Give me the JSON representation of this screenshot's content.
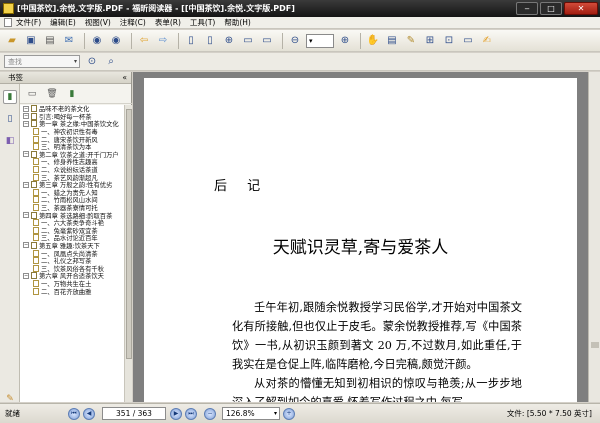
{
  "window": {
    "title": "[中国茶饮].余悦.文字版.PDF - 福昕阅读器 - [[中国茶饮].余悦.文字版.PDF]"
  },
  "menu": [
    "文件(F)",
    "编辑(E)",
    "视图(V)",
    "注释(C)",
    "表单(R)",
    "工具(T)",
    "帮助(H)"
  ],
  "toolbar": {
    "icons": [
      "open-icon",
      "save-icon",
      "print-icon",
      "email-icon",
      "first-page-icon",
      "prev-page-icon",
      "back-icon",
      "forward-icon",
      "single-page-icon",
      "facing-icon",
      "zoom-in-icon",
      "fit-page-icon",
      "fit-width-icon",
      "zoom-out-icon",
      "zoom-plus-icon",
      "hand-tool-icon",
      "select-text-icon",
      "snapshot-icon",
      "comment-icon",
      "link-icon",
      "typewriter-icon",
      "note-icon"
    ]
  },
  "search": {
    "placeholder": "查找"
  },
  "left_panel": {
    "header": "书签",
    "bookmarks": [
      {
        "level": 1,
        "label": "品味不老的茶文化"
      },
      {
        "level": 1,
        "label": "引言:喝好每一杯茶"
      },
      {
        "level": 1,
        "label": "第一章 茶之缘:中国茶饮文化"
      },
      {
        "level": 2,
        "label": "一、神农初识性有毒"
      },
      {
        "level": 2,
        "label": "二、唐宋茶饮开新风"
      },
      {
        "level": 2,
        "label": "三、明清茶饮为本"
      },
      {
        "level": 1,
        "label": "第二章 饮茶之道:开千门万户"
      },
      {
        "level": 2,
        "label": "一、修身养性志趣高"
      },
      {
        "level": 2,
        "label": "二、众说纷纭话茶道"
      },
      {
        "level": 2,
        "label": "三、茶艺风韵渐超凡"
      },
      {
        "level": 1,
        "label": "第三章 万般之韵:性有优劣"
      },
      {
        "level": 2,
        "label": "一、蜡之为贵先人知"
      },
      {
        "level": 2,
        "label": "二、竹雨松风山水间"
      },
      {
        "level": 2,
        "label": "三、茶器茶寮情可托"
      },
      {
        "level": 1,
        "label": "第四章 茶选路细:酌取百茶"
      },
      {
        "level": 2,
        "label": "一、六大茶类争奇斗艳"
      },
      {
        "level": 2,
        "label": "二、兔毫紫砂双宜茶"
      },
      {
        "level": 2,
        "label": "三、品水讨论近百年"
      },
      {
        "level": 1,
        "label": "第五章 雅趣:饮茶天下"
      },
      {
        "level": 2,
        "label": "一、凤凰点头尚清茶"
      },
      {
        "level": 2,
        "label": "二、礼仪之邦写茶"
      },
      {
        "level": 2,
        "label": "三、饮茶风俗各有千秋"
      },
      {
        "level": 1,
        "label": "第六章 风开合适茶饮天"
      },
      {
        "level": 2,
        "label": "一、万物共生在土"
      },
      {
        "level": 2,
        "label": "二、百花齐放曲雅"
      }
    ]
  },
  "document": {
    "heading": "后 记",
    "title": "天赋识灵草,寄与爱茶人",
    "paragraphs": [
      "壬午年初,跟随余悦教授学习民俗学,才开始对中国茶文化有所接触,但也仅止于皮毛。蒙余悦教授推荐,写《中国茶饮》一书,从初识玉颜到著文 20 万,不过数月,如此重任,于我实在是仓促上阵,临阵磨枪,今日完稿,颇觉汗颜。",
      "从对茶的懵懂无知到初相识的惊叹与艳羡;从一步步地深入了解到如今的喜爱,怀着写作过程之中,每写"
    ]
  },
  "status": {
    "ready": "就绪",
    "page": "351 / 363",
    "zoom": "126.8%",
    "doc_size": "文件: [5.50 * 7.50 英寸]"
  }
}
